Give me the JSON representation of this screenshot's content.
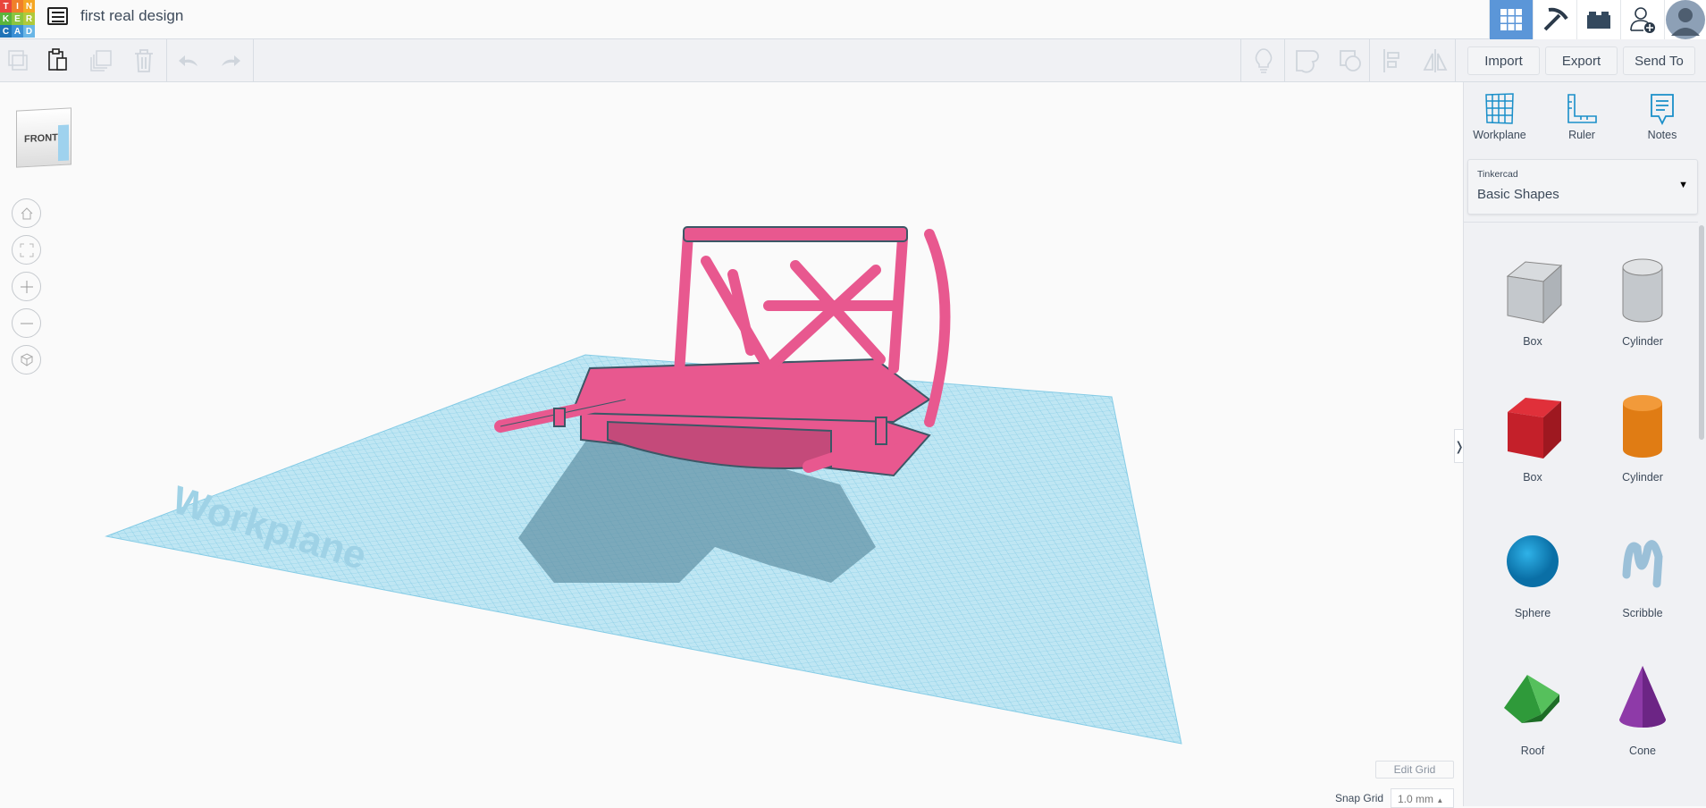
{
  "logo": {
    "letters": [
      "T",
      "I",
      "N",
      "K",
      "E",
      "R",
      "C",
      "A",
      "D"
    ],
    "colors": [
      "#e8453c",
      "#f07f2a",
      "#f5a623",
      "#5bb43c",
      "#8cc43f",
      "#b0c93a",
      "#1f73b7",
      "#3b8fd4",
      "#6ab6e6"
    ]
  },
  "header": {
    "title": "first real design",
    "icons": [
      "grid-view-icon",
      "pickaxe-icon",
      "brick-icon",
      "add-user-icon",
      "avatar"
    ]
  },
  "toolbar": {
    "tools": [
      "copy-icon",
      "paste-icon",
      "duplicate-icon",
      "delete-icon",
      "undo-icon",
      "redo-icon",
      "light-bulb-icon",
      "group-icon",
      "ungroup-icon",
      "align-icon",
      "mirror-icon"
    ],
    "import": "Import",
    "export": "Export",
    "send_to": "Send To"
  },
  "panel": {
    "tools": [
      {
        "label": "Workplane"
      },
      {
        "label": "Ruler"
      },
      {
        "label": "Notes"
      }
    ],
    "library_source": "Tinkercad",
    "library": "Basic Shapes",
    "shapes": [
      {
        "label": "Box"
      },
      {
        "label": "Cylinder"
      },
      {
        "label": "Box"
      },
      {
        "label": "Cylinder"
      },
      {
        "label": "Sphere"
      },
      {
        "label": "Scribble"
      },
      {
        "label": "Roof"
      },
      {
        "label": "Cone"
      }
    ]
  },
  "viewport": {
    "view_cube_face": "FRONT",
    "workplane_label": "Workplane",
    "edit_grid": "Edit Grid",
    "snap_grid_label": "Snap Grid",
    "snap_grid_value": "1.0 mm"
  },
  "colors": {
    "accent": "#5b96d8",
    "model": "#e8588f",
    "workplane": "#a9dcef"
  }
}
